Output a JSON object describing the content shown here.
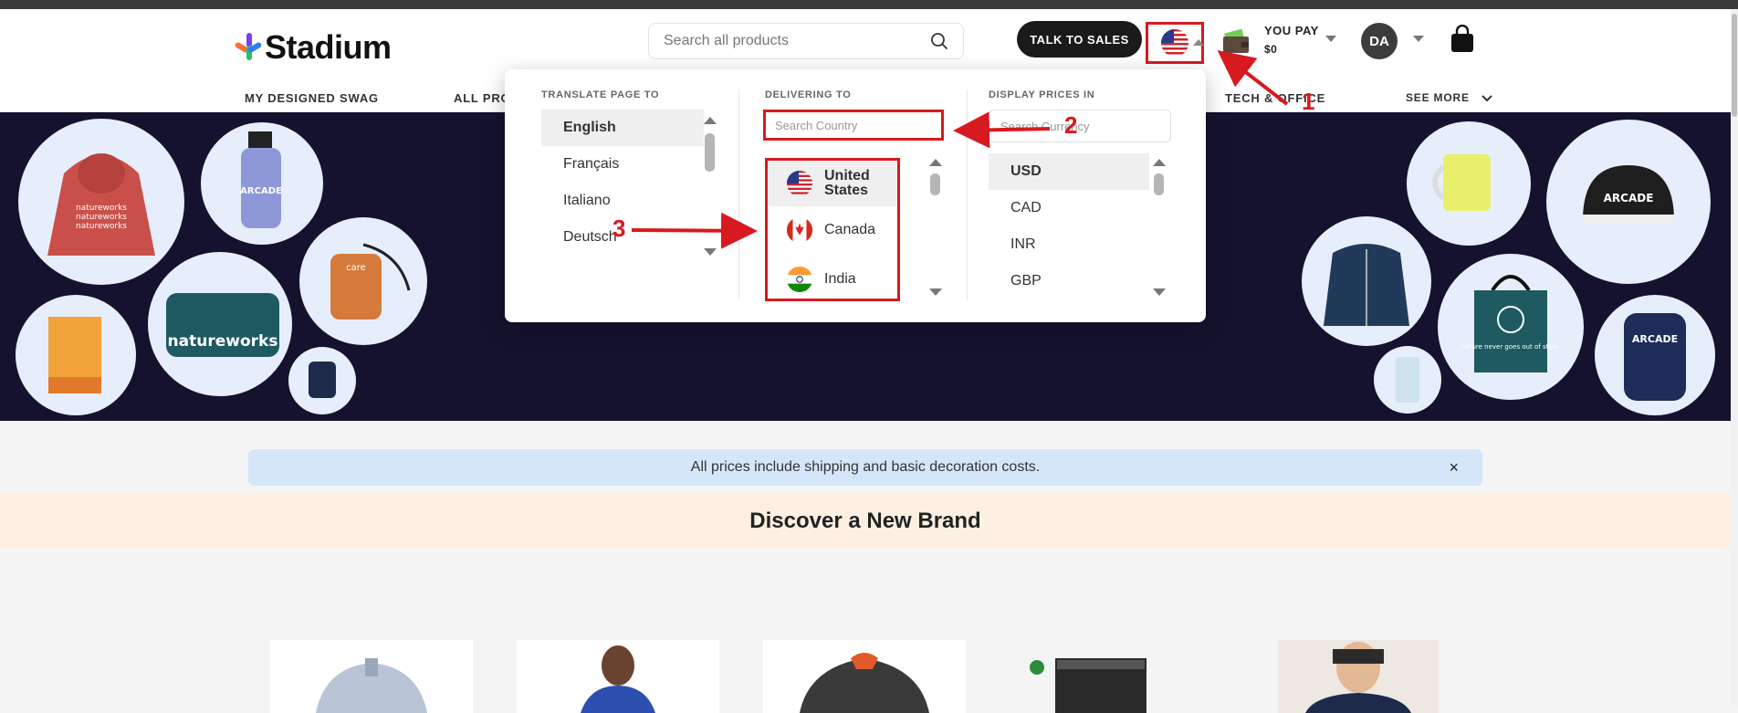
{
  "header": {
    "logo_text": "Stadium",
    "search_placeholder": "Search all products",
    "talk_to_sales": "TALK TO SALES",
    "you_pay_label": "YOU PAY",
    "you_pay_value": "$0",
    "avatar_initials": "DA"
  },
  "nav": {
    "items": [
      "MY DESIGNED SWAG",
      "ALL PRO",
      "TECH & OFFICE",
      "SEE MORE"
    ]
  },
  "dropdown": {
    "translate": {
      "title": "TRANSLATE PAGE TO",
      "options": [
        "English",
        "Français",
        "Italiano",
        "Deutsch"
      ],
      "selected": "English"
    },
    "delivering": {
      "title": "DELIVERING TO",
      "search_placeholder": "Search Country",
      "options": [
        "United States",
        "Canada",
        "India"
      ],
      "selected": "United States"
    },
    "prices": {
      "title": "DISPLAY PRICES IN",
      "search_placeholder": "Search Currency",
      "options": [
        "USD",
        "CAD",
        "INR",
        "GBP"
      ],
      "selected": "USD"
    }
  },
  "hero": {
    "bubble_texts": [
      "natureworks",
      "care",
      "ARCADE",
      "nature never goes out of style."
    ]
  },
  "notice": {
    "text": "All prices include shipping and basic decoration costs.",
    "close": "×"
  },
  "brand_section": {
    "title": "Discover a New Brand"
  },
  "annotations": {
    "labels": [
      "1",
      "2",
      "3"
    ],
    "color": "#d71920"
  },
  "colors": {
    "hero_bg": "#15122f",
    "accent_red": "#d71920",
    "notice_bg": "#d5e6fb",
    "brand_band_bg": "#fdf0e2"
  }
}
